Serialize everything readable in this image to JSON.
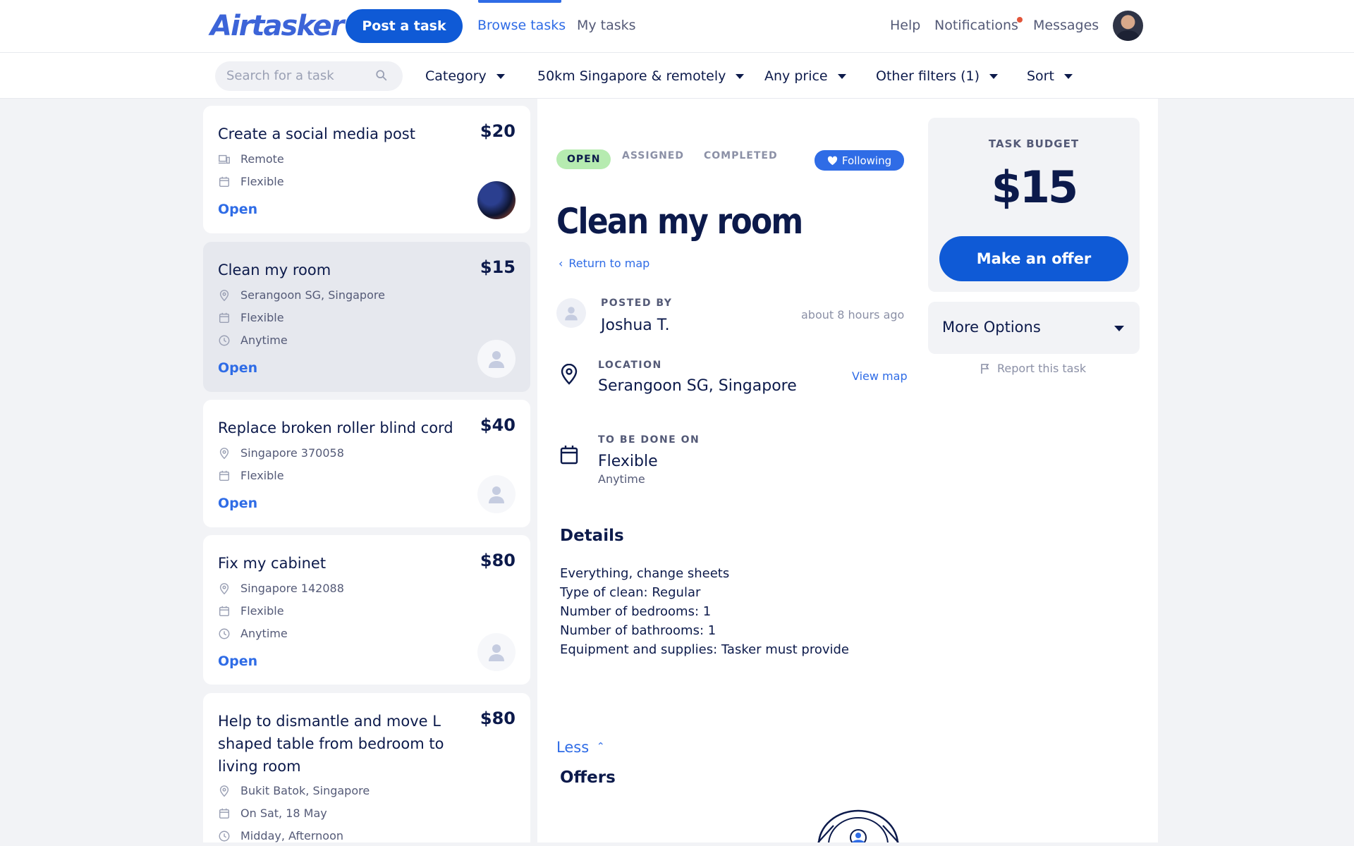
{
  "nav": {
    "logo": "Airtasker",
    "post_task": "Post a task",
    "browse_tasks": "Browse tasks",
    "my_tasks": "My tasks",
    "help": "Help",
    "notifications": "Notifications",
    "messages": "Messages"
  },
  "filters": {
    "search_placeholder": "Search for a task",
    "category": "Category",
    "location": "50km Singapore & remotely",
    "price": "Any price",
    "other": "Other filters (1)",
    "sort": "Sort"
  },
  "tasks": [
    {
      "title": "Create a social media post",
      "price": "$20",
      "rows": [
        "Remote",
        "Flexible"
      ],
      "status": "Open"
    },
    {
      "title": "Clean my room",
      "price": "$15",
      "rows": [
        "Serangoon SG, Singapore",
        "Flexible",
        "Anytime"
      ],
      "status": "Open"
    },
    {
      "title": "Replace broken roller blind cord",
      "price": "$40",
      "rows": [
        "Singapore 370058",
        "Flexible"
      ],
      "status": "Open"
    },
    {
      "title": "Fix my cabinet",
      "price": "$80",
      "rows": [
        "Singapore 142088",
        "Flexible",
        "Anytime"
      ],
      "status": "Open"
    },
    {
      "title": "Help to dismantle and move L shaped table from bedroom to living room",
      "price": "$80",
      "rows": [
        "Bukit Batok, Singapore",
        "On Sat, 18 May",
        "Midday, Afternoon"
      ],
      "status": "Open"
    }
  ],
  "detail": {
    "status_open": "OPEN",
    "status_assigned": "ASSIGNED",
    "status_completed": "COMPLETED",
    "following": "Following",
    "title": "Clean my room",
    "return_to_map": "Return to map",
    "posted_by_label": "POSTED BY",
    "posted_by": "Joshua T.",
    "posted_time": "about 8 hours ago",
    "location_label": "LOCATION",
    "location": "Serangoon SG, Singapore",
    "view_map": "View map",
    "done_on_label": "TO BE DONE ON",
    "done_on": "Flexible",
    "done_time": "Anytime",
    "details_heading": "Details",
    "details_lines": [
      "Everything, change sheets",
      "Type of clean: Regular",
      "Number of bedrooms: 1",
      "Number of bathrooms: 1",
      "Equipment and supplies: Tasker must provide"
    ],
    "less": "Less",
    "offers_heading": "Offers"
  },
  "sidebar": {
    "budget_label": "TASK BUDGET",
    "budget": "$15",
    "make_offer": "Make an offer",
    "more_options": "More Options",
    "report": "Report this task"
  },
  "colors": {
    "accent": "#2f6ce6",
    "primary_button": "#0f5ad6",
    "open_badge": "#b6ebb0",
    "notification_dot": "#e2553a",
    "text_dark": "#0c1a4b"
  }
}
